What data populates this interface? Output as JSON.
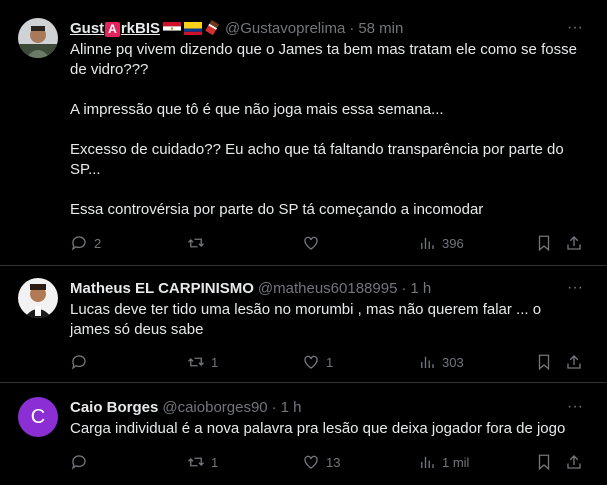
{
  "tweets": [
    {
      "name_prefix": "Gust",
      "name_badge": "A",
      "name_suffix": "rkBIS",
      "handle": "@Gustavoprelima",
      "dot": "·",
      "time": "58 min",
      "text": [
        "Alinne pq vivem dizendo que o James ta bem mas tratam ele como se fosse de vidro???",
        "A impressão que tô é que não joga mais essa semana...",
        "Excesso de cuidado?? Eu acho que tá faltando transparência por parte do SP...",
        "Essa controvérsia por parte do SP tá começando a incomodar"
      ],
      "replies": "2",
      "reposts": "",
      "likes": "",
      "views": "396"
    },
    {
      "name": "Matheus EL CARPINISMO",
      "handle": "@matheus60188995",
      "dot": "·",
      "time": "1 h",
      "text": "Lucas deve ter tido uma lesão no morumbi , mas não querem falar ... o james só deus sabe",
      "replies": "",
      "reposts": "1",
      "likes": "1",
      "views": "303"
    },
    {
      "name": "Caio Borges",
      "handle": "@caioborges90",
      "dot": "·",
      "time": "1 h",
      "avatar_letter": "C",
      "text": "Carga individual é a nova palavra pra lesão que deixa jogador fora de jogo",
      "replies": "",
      "reposts": "1",
      "likes": "13",
      "views": "1 mil"
    }
  ],
  "colors": {
    "background": "#000000",
    "text": "#e7e9ea",
    "muted": "#71767b",
    "divider": "#2f3336",
    "avatar_purple": "#8b2fd4",
    "badge_red": "#e0245e"
  },
  "more_icon": "···"
}
